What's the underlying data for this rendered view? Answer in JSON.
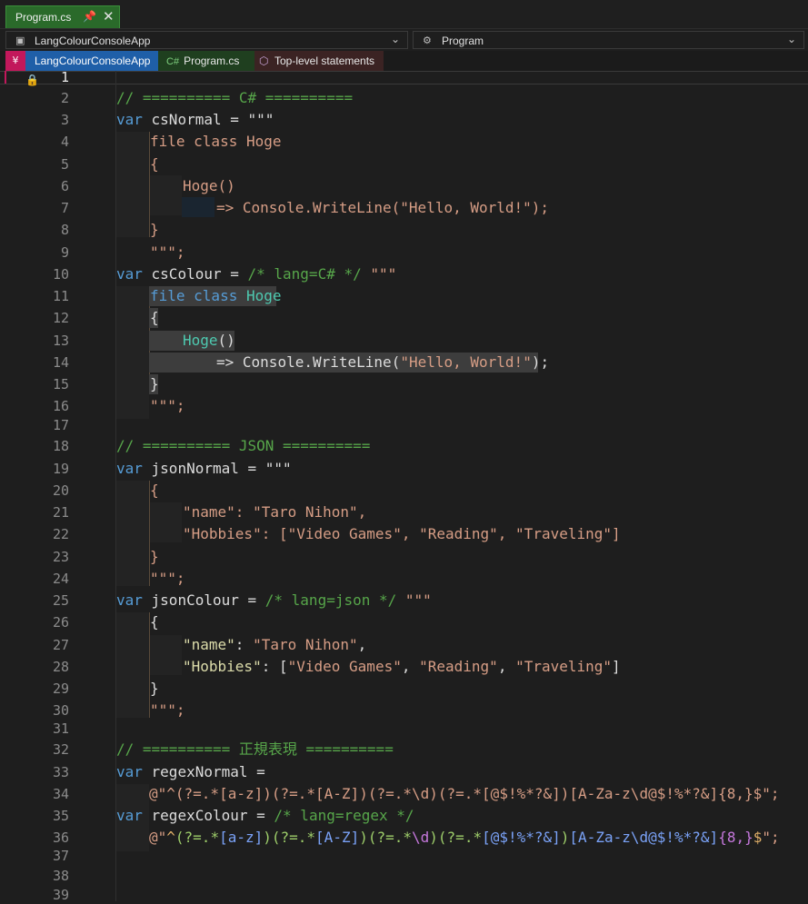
{
  "tab": {
    "label": "Program.cs",
    "pin": "📌",
    "close": "✕"
  },
  "nav": {
    "project": "LangColourConsoleApp",
    "member": "Program",
    "chevron": "⌄",
    "project_icon": "▣",
    "member_icon": "⚙"
  },
  "breadcrumb": {
    "root_icon": "¥",
    "project": "LangColourConsoleApp",
    "file_prefix": "C#",
    "file": "Program.cs",
    "scope": "Top-level statements",
    "scope_icon": "⬡"
  },
  "editor": {
    "lock_icon": "🔒",
    "line_numbers": [
      "1",
      "2",
      "3",
      "4",
      "5",
      "6",
      "7",
      "8",
      "9",
      "10",
      "11",
      "12",
      "13",
      "14",
      "15",
      "16",
      "17",
      "18",
      "19",
      "20",
      "21",
      "22",
      "23",
      "24",
      "25",
      "26",
      "27",
      "28",
      "29",
      "30",
      "31",
      "32",
      "33",
      "34",
      "35",
      "36",
      "37",
      "38",
      "39"
    ],
    "code": {
      "l2": "// ========== C# ==========",
      "l3_kw": "var",
      "l3_id": " csNormal = \"\"\"",
      "l4": "file class Hoge",
      "l5": "{",
      "l6": "Hoge()",
      "l7": "=> Console.WriteLine(\"Hello, World!\");",
      "l8": "}",
      "l9": "\"\"\";",
      "l10_kw": "var",
      "l10_id": " csColour = ",
      "l10_com": "/* lang=C# */",
      "l10_str": " \"\"\"",
      "l11_kw": "file class",
      "l11_cls": " Hoge",
      "l12": "{",
      "l13_m": "Hoge",
      "l13_p": "()",
      "l14_a": "=> ",
      "l14_c": "Console",
      "l14_d": ".",
      "l14_m": "WriteLine",
      "l14_p1": "(",
      "l14_s": "\"Hello, World!\"",
      "l14_p2": ");",
      "l15": "}",
      "l16": "\"\"\";",
      "l18": "// ========== JSON ==========",
      "l19_kw": "var",
      "l19_id": " jsonNormal = \"\"\"",
      "l20": "{",
      "l21": "\"name\": \"Taro Nihon\",",
      "l22": "\"Hobbies\": [\"Video Games\", \"Reading\", \"Traveling\"]",
      "l23": "}",
      "l24": "\"\"\";",
      "l25_kw": "var",
      "l25_id": " jsonColour = ",
      "l25_com": "/* lang=json */",
      "l25_str": " \"\"\"",
      "l26": "{",
      "l27_k": "\"name\"",
      "l27_p": ": ",
      "l27_v": "\"Taro Nihon\"",
      "l27_e": ",",
      "l28_k": "\"Hobbies\"",
      "l28_p": ": [",
      "l28_v1": "\"Video Games\"",
      "l28_c1": ", ",
      "l28_v2": "\"Reading\"",
      "l28_c2": ", ",
      "l28_v3": "\"Traveling\"",
      "l28_e": "]",
      "l29": "}",
      "l30": "\"\"\";",
      "l32": "// ========== 正規表現 ==========",
      "l33_kw": "var",
      "l33_id": " regexNormal =",
      "l34": "@\"^(?=.*[a-z])(?=.*[A-Z])(?=.*\\d)(?=.*[@$!%*?&])[A-Za-z\\d@$!%*?&]{8,}$\";",
      "l35_kw": "var",
      "l35_id": " regexColour = ",
      "l35_com": "/* lang=regex */",
      "l36_a": "@\"",
      "l36_b": "^",
      "l36_c": "(?=.*",
      "l36_d": "[a-z]",
      "l36_e": ")(?=.*",
      "l36_f": "[A-Z]",
      "l36_g": ")(?=.*",
      "l36_h": "\\d",
      "l36_i": ")(?=.*",
      "l36_j": "[@$!%*?&]",
      "l36_k": ")",
      "l36_l": "[A-Za-z\\d@$!%*?&]",
      "l36_m": "{8,}",
      "l36_n": "$",
      "l36_o": "\";"
    }
  }
}
